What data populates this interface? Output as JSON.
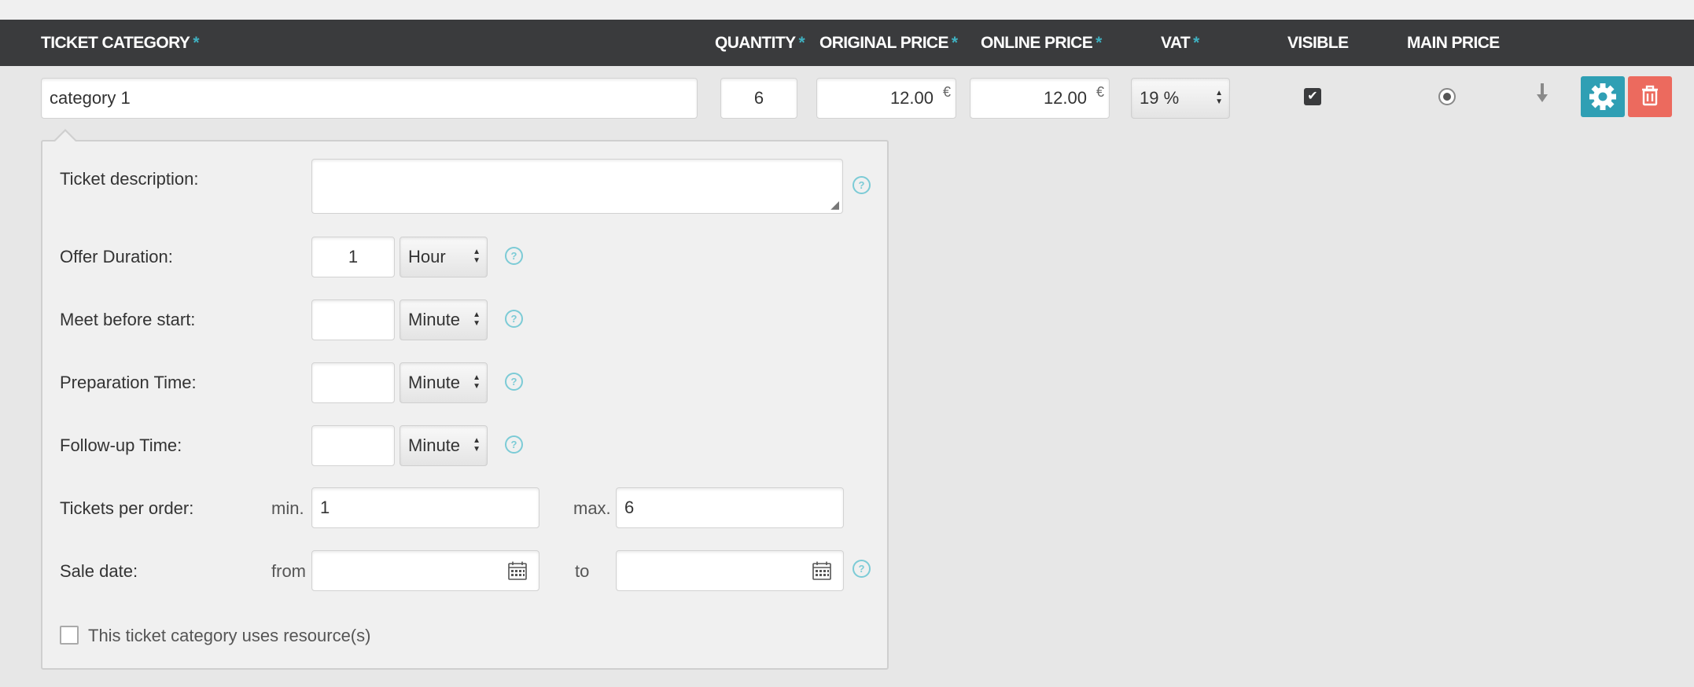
{
  "header": {
    "ticket_category": "TICKET CATEGORY",
    "quantity": "QUANTITY",
    "original_price": "ORIGINAL PRICE",
    "online_price": "ONLINE PRICE",
    "vat": "VAT",
    "visible": "VISIBLE",
    "main_price": "MAIN PRICE",
    "required_marker": "*"
  },
  "row": {
    "category_name": "category 1",
    "quantity": "6",
    "original_price": "12.00",
    "online_price": "12.00",
    "currency": "€",
    "vat": "19 %",
    "visible_checked": true,
    "main_price_selected": true
  },
  "details": {
    "ticket_description_label": "Ticket description:",
    "ticket_description_value": "",
    "offer_duration_label": "Offer Duration:",
    "offer_duration_value": "1",
    "offer_duration_unit": "Hour",
    "meet_before_start_label": "Meet before start:",
    "meet_before_start_value": "",
    "meet_before_start_unit": "Minute",
    "preparation_time_label": "Preparation Time:",
    "preparation_time_value": "",
    "preparation_time_unit": "Minute",
    "follow_up_time_label": "Follow-up Time:",
    "follow_up_time_value": "",
    "follow_up_time_unit": "Minute",
    "tickets_per_order_label": "Tickets per order:",
    "min_label": "min.",
    "min_value": "1",
    "max_label": "max.",
    "max_value": "6",
    "sale_date_label": "Sale date:",
    "from_label": "from",
    "to_label": "to",
    "sale_from_value": "",
    "sale_to_value": "",
    "uses_resources_label": "This ticket category uses resource(s)",
    "uses_resources_checked": false
  },
  "icons": {
    "help": "help-icon",
    "calendar": "calendar-icon",
    "gear": "gear-icon",
    "trash": "trash-icon",
    "down": "arrow-down-icon"
  },
  "colors": {
    "header_bg": "#3a3b3d",
    "accent": "#3fb0c0",
    "settings_button": "#2f9fb4",
    "delete_button": "#ec6a5e"
  }
}
